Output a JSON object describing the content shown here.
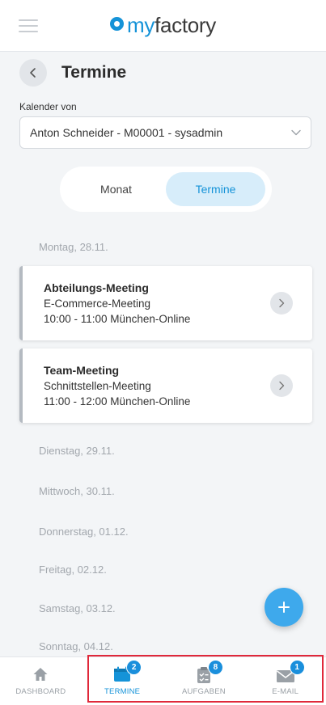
{
  "app": {
    "logo_my": "my",
    "logo_factory": "factory"
  },
  "header": {
    "title": "Termine"
  },
  "calendar": {
    "label": "Kalender von",
    "selected": "Anton Schneider - M00001 - sysadmin"
  },
  "view_toggle": {
    "month_label": "Monat",
    "appointments_label": "Termine",
    "active": "Termine"
  },
  "days": [
    {
      "label": "Montag, 28.11.",
      "events": [
        {
          "title": "Abteilungs-Meeting",
          "subtitle": "E-Commerce-Meeting",
          "details": "10:00 - 11:00 München-Online"
        },
        {
          "title": "Team-Meeting",
          "subtitle": "Schnittstellen-Meeting",
          "details": "11:00 - 12:00 München-Online"
        }
      ]
    },
    {
      "label": "Dienstag, 29.11.",
      "events": []
    },
    {
      "label": "Mittwoch, 30.11.",
      "events": []
    },
    {
      "label": "Donnerstag, 01.12.",
      "events": []
    },
    {
      "label": "Freitag, 02.12.",
      "events": []
    },
    {
      "label": "Samstag, 03.12.",
      "events": []
    },
    {
      "label": "Sonntag, 04.12.",
      "events": []
    }
  ],
  "fab": {
    "icon": "plus-icon",
    "label": "+"
  },
  "bottom_nav": [
    {
      "label": "DASHBOARD",
      "icon": "home-icon",
      "badge": null,
      "active": false
    },
    {
      "label": "TERMINE",
      "icon": "calendar-icon",
      "badge": "2",
      "active": true
    },
    {
      "label": "AUFGABEN",
      "icon": "clipboard-icon",
      "badge": "8",
      "active": false
    },
    {
      "label": "E-MAIL",
      "icon": "mail-icon",
      "badge": "1",
      "active": false
    }
  ],
  "colors": {
    "accent": "#1593d8",
    "highlight_border": "#e0283a",
    "fab": "#3ea9ec"
  }
}
